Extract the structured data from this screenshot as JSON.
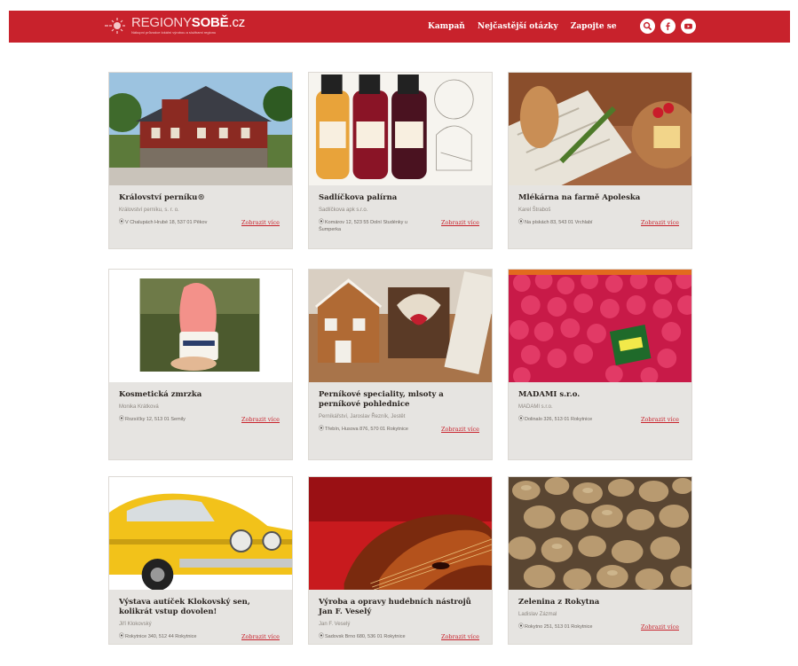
{
  "brand": {
    "title_light": "REGIONY",
    "title_bold": "SOBĚ",
    "title_suffix": ".cz",
    "tagline": "Nákupní průvodce lokální výrobou a službami regionu"
  },
  "nav": {
    "items": [
      "Kampaň",
      "Nejčastější otázky",
      "Zapojte se"
    ]
  },
  "socials": [
    "search-icon",
    "facebook-icon",
    "youtube-icon"
  ],
  "colors": {
    "brand_red": "#c8222c",
    "card_bg": "#e6e4e1"
  },
  "cards": [
    {
      "title": "Království perníku®",
      "company": "Království perníku, s. r. o.",
      "address": "V Chalupách Hrubé 18, 537 01 Pěkov",
      "more": "Zobrazit více"
    },
    {
      "title": "Sadlíčkova palírna",
      "company": "Sadlíčkova apk s.r.o.",
      "address": "Komárov 12, 523 55 Dolní Studénky u Šumperka",
      "more": "Zobrazit více"
    },
    {
      "title": "Mlékárna na farmě Apoleska",
      "company": "Karel Štraboš",
      "address": "Na pískách 83, 543 01 Vrchlabí",
      "more": "Zobrazit více"
    },
    {
      "title": "Kosmetická zmrzka",
      "company": "Monika Krátková",
      "address": "Rozsíčky 12, 513 01 Semily",
      "more": "Zobrazit více"
    },
    {
      "title": "Perníkové speciality, mlsoty a perníkové pohlednice",
      "company": "Perníkářství, Jaroslav Řezník, Jestět",
      "address": "Třebín, Husova 876, 570 01 Rokytnice",
      "more": "Zobrazit více"
    },
    {
      "title": "MADAMI s.r.o.",
      "company": "MADAMI s.r.o.",
      "address": "Dolinalo 326, 513 01 Rokytnice",
      "more": "Zobrazit více"
    },
    {
      "title": "Výstava autíček Klokovský sen, kolikrát vstup dovolen!",
      "company": "Jiří Klokovský",
      "address": "Rokytnice 340, 512 44 Rokytnice",
      "more": "Zobrazit více"
    },
    {
      "title": "Výroba a opravy hudebních nástrojů Jan F. Veselý",
      "company": "Jan F. Veselý",
      "address": "Sadovsk Brno 680, 536 01 Rokytnice",
      "more": "Zobrazit více"
    },
    {
      "title": "Zelenina z Rokytna",
      "company": "Ladislav Zázmal",
      "address": "Rokytno 251, 513 01 Rokytnice",
      "more": "Zobrazit více"
    }
  ]
}
